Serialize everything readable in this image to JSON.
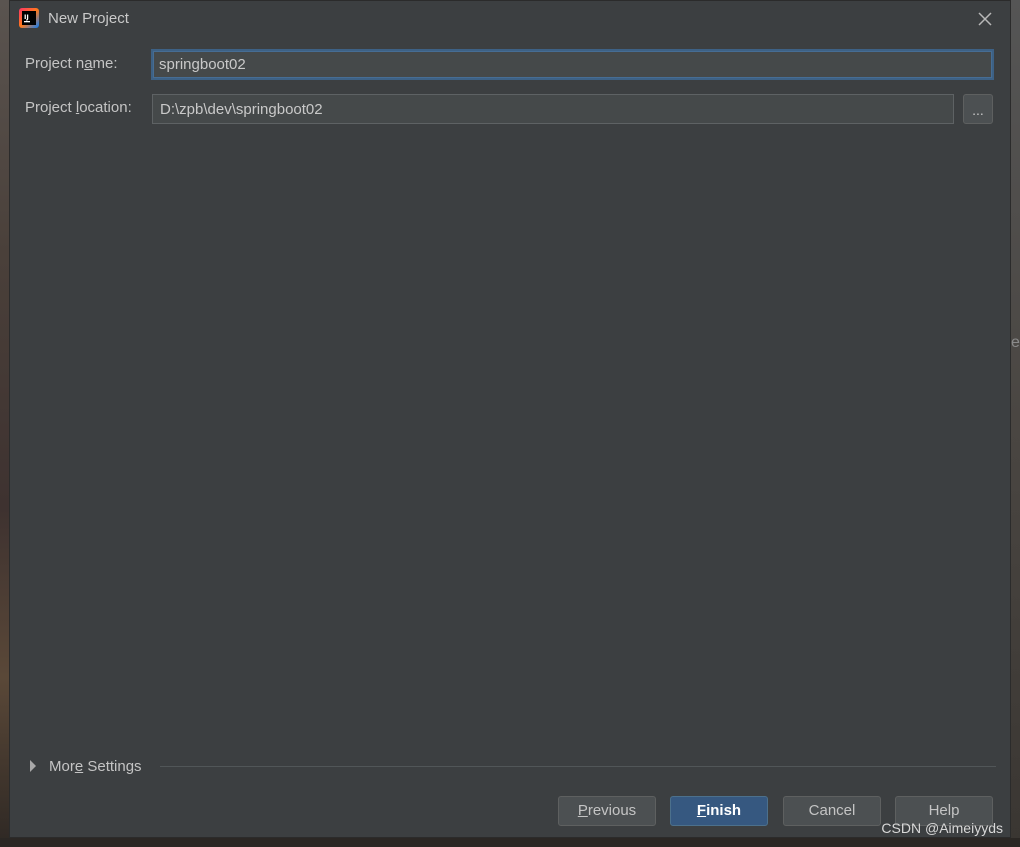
{
  "window": {
    "title": "New Project",
    "icon": "intellij-idea-icon",
    "close_icon": "close-icon"
  },
  "form": {
    "project_name": {
      "label_before": "Project n",
      "label_mnemonic": "a",
      "label_after": "me:",
      "value": "springboot02"
    },
    "project_location": {
      "label_before": "Project ",
      "label_mnemonic": "l",
      "label_after": "ocation:",
      "value": "D:\\zpb\\dev\\springboot02",
      "browse_label": "..."
    }
  },
  "more_settings": {
    "label_before": "Mor",
    "label_mnemonic": "e",
    "label_after": " Settings",
    "expanded": false
  },
  "buttons": {
    "previous": {
      "mnemonic": "P",
      "rest": "revious"
    },
    "finish": {
      "mnemonic": "F",
      "rest": "inish"
    },
    "cancel": "Cancel",
    "help": "Help"
  },
  "watermark": "CSDN @Aimeiyyds",
  "edge_glyph": "e",
  "colors": {
    "dialog_bg": "#3c3f41",
    "field_bg": "#45494a",
    "focus_border": "#3d6185",
    "primary_button": "#365880"
  }
}
